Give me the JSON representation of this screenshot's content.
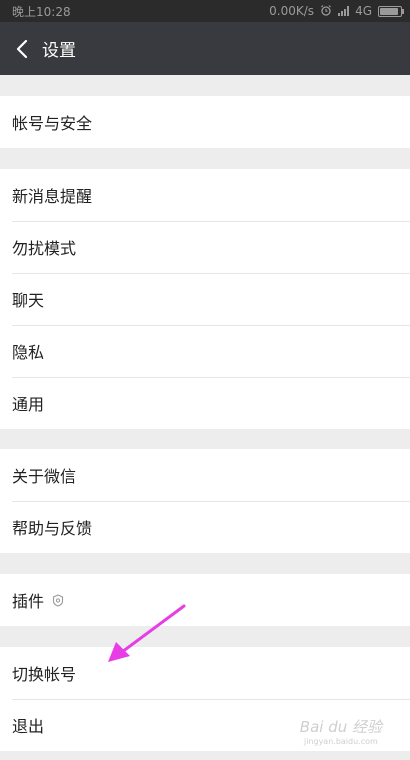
{
  "status_bar": {
    "time": "晚上10:28",
    "net_speed": "0.00K/s",
    "network": "4G",
    "battery_level": 0.9
  },
  "header": {
    "title": "设置"
  },
  "groups": [
    {
      "items": [
        {
          "label": "帐号与安全"
        }
      ]
    },
    {
      "items": [
        {
          "label": "新消息提醒"
        },
        {
          "label": "勿扰模式"
        },
        {
          "label": "聊天"
        },
        {
          "label": "隐私"
        },
        {
          "label": "通用"
        }
      ]
    },
    {
      "items": [
        {
          "label": "关于微信"
        },
        {
          "label": "帮助与反馈"
        }
      ]
    },
    {
      "items": [
        {
          "label": "插件"
        }
      ]
    },
    {
      "items": [
        {
          "label": "切换帐号"
        },
        {
          "label": "退出"
        }
      ]
    }
  ],
  "watermark": {
    "text": "Bai du 经验",
    "url": "jingyan.baidu.com"
  },
  "colors": {
    "titlebar": "#393a3f",
    "background": "#ededed",
    "annotation_arrow": "#e83ce6"
  }
}
